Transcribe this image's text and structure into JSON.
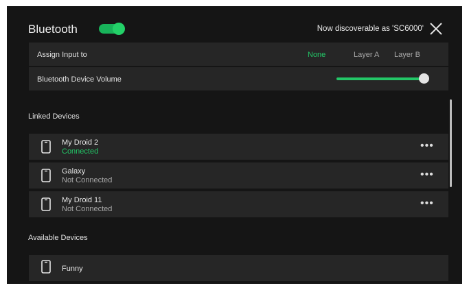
{
  "header": {
    "title": "Bluetooth",
    "bluetooth_enabled": true,
    "discoverable_text": "Now discoverable as 'SC6000'",
    "close_icon": "close-icon"
  },
  "assign_input": {
    "label": "Assign Input to",
    "options": [
      "None",
      "Layer A",
      "Layer B"
    ],
    "selected": "None"
  },
  "volume": {
    "label": "Bluetooth Device Volume",
    "level_fraction": 0.95
  },
  "linked_devices": {
    "heading": "Linked Devices",
    "items": [
      {
        "name": "My Droid 2",
        "status": "Connected",
        "connected": true
      },
      {
        "name": "Galaxy",
        "status": "Not Connected",
        "connected": false
      },
      {
        "name": "My Droid 11",
        "status": "Not Connected",
        "connected": false
      }
    ],
    "more_glyph": "•••"
  },
  "available_devices": {
    "heading": "Available Devices",
    "items": [
      {
        "name": "Funny"
      }
    ]
  },
  "colors": {
    "accent": "#23c767",
    "background": "#151515",
    "row_background": "#262626",
    "text": "#e3e3e3",
    "muted_text": "#a8a8a8"
  },
  "icons": {
    "device": "phone-icon",
    "more": "more-options-icon",
    "close": "close-icon"
  }
}
